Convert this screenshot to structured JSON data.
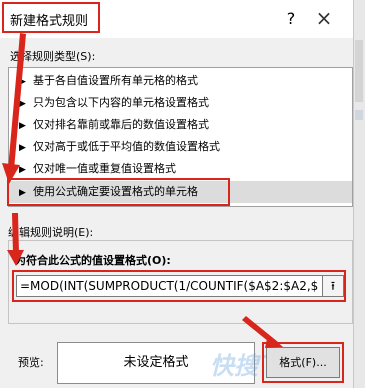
{
  "window": {
    "title": "新建格式规则",
    "help_label": "?",
    "close_label": "×"
  },
  "rule_type": {
    "label": "选择规则类型(S):",
    "items": [
      {
        "label": "基于各自值设置所有单元格的格式",
        "selected": false
      },
      {
        "label": "只为包含以下内容的单元格设置格式",
        "selected": false
      },
      {
        "label": "仅对排名靠前或靠后的数值设置格式",
        "selected": false
      },
      {
        "label": "仅对高于或低于平均值的数值设置格式",
        "selected": false
      },
      {
        "label": "仅对唯一值或重复值设置格式",
        "selected": false
      },
      {
        "label": "使用公式确定要设置格式的单元格",
        "selected": true
      }
    ]
  },
  "description": {
    "label": "编辑规则说明(E):",
    "formula_label": "为符合此公式的值设置格式(O):",
    "formula_value": "=MOD(INT(SUMPRODUCT(1/COUNTIF($A$2:$A2,$",
    "collapse_icon": "collapse-dialog-icon"
  },
  "preview": {
    "label": "预览:",
    "sample_text": "未设定格式",
    "format_button": "格式(F)..."
  },
  "watermark": "快搜下载",
  "annotation_color": "#d9261c"
}
